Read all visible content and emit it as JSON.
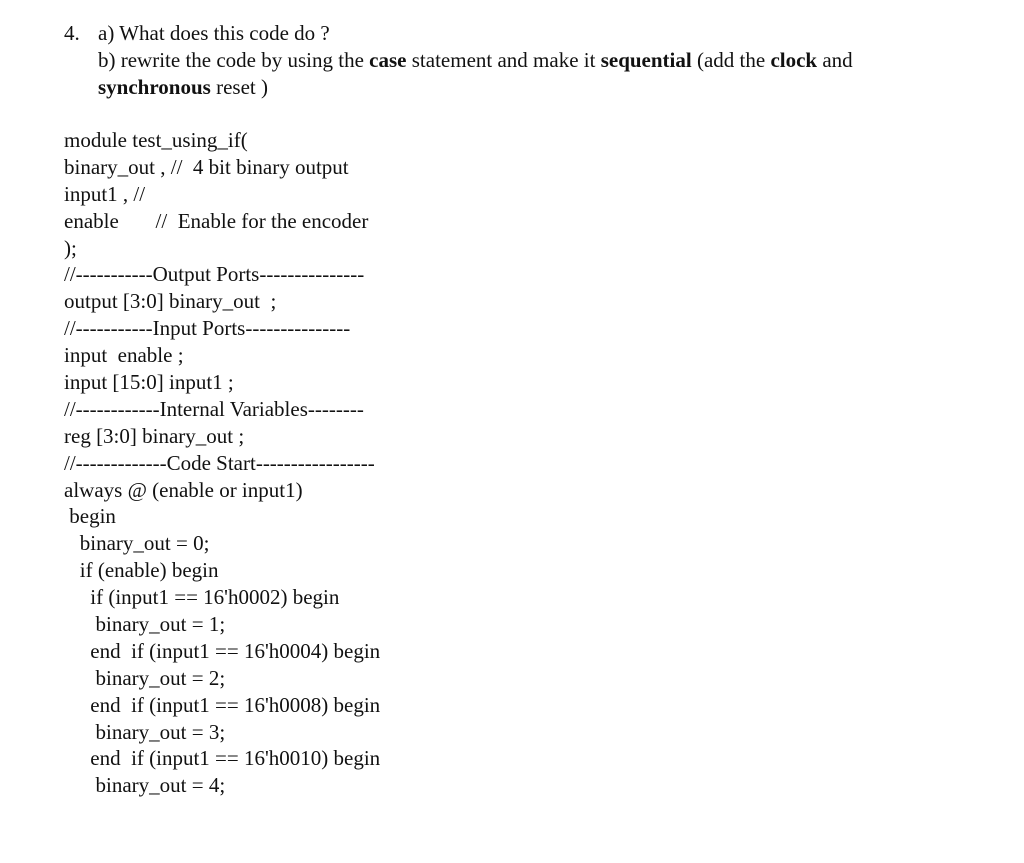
{
  "question": {
    "number": "4.",
    "part_a": "a) What does this code do ?",
    "part_b": {
      "pre_case": "b) rewrite the code by using the ",
      "case": "case",
      "mid1": " statement and make it ",
      "sequential": "sequential",
      "mid2": " (add the ",
      "clock": "clock",
      "mid3": " and",
      "synchronous": "synchronous",
      "post": " reset )"
    }
  },
  "code_lines": [
    "module test_using_if(",
    "binary_out , //  4 bit binary output",
    "input1 , //",
    "enable       //  Enable for the encoder",
    ");",
    "//-----------Output Ports---------------",
    "output [3:0] binary_out  ;",
    "//-----------Input Ports---------------",
    "input  enable ;",
    "input [15:0] input1 ;",
    "//------------Internal Variables--------",
    "reg [3:0] binary_out ;",
    "//-------------Code Start-----------------",
    "always @ (enable or input1)",
    " begin",
    "   binary_out = 0;",
    "   if (enable) begin",
    "     if (input1 == 16'h0002) begin",
    "      binary_out = 1;",
    "     end  if (input1 == 16'h0004) begin",
    "      binary_out = 2;",
    "     end  if (input1 == 16'h0008) begin",
    "      binary_out = 3;",
    "     end  if (input1 == 16'h0010) begin",
    "      binary_out = 4;"
  ]
}
